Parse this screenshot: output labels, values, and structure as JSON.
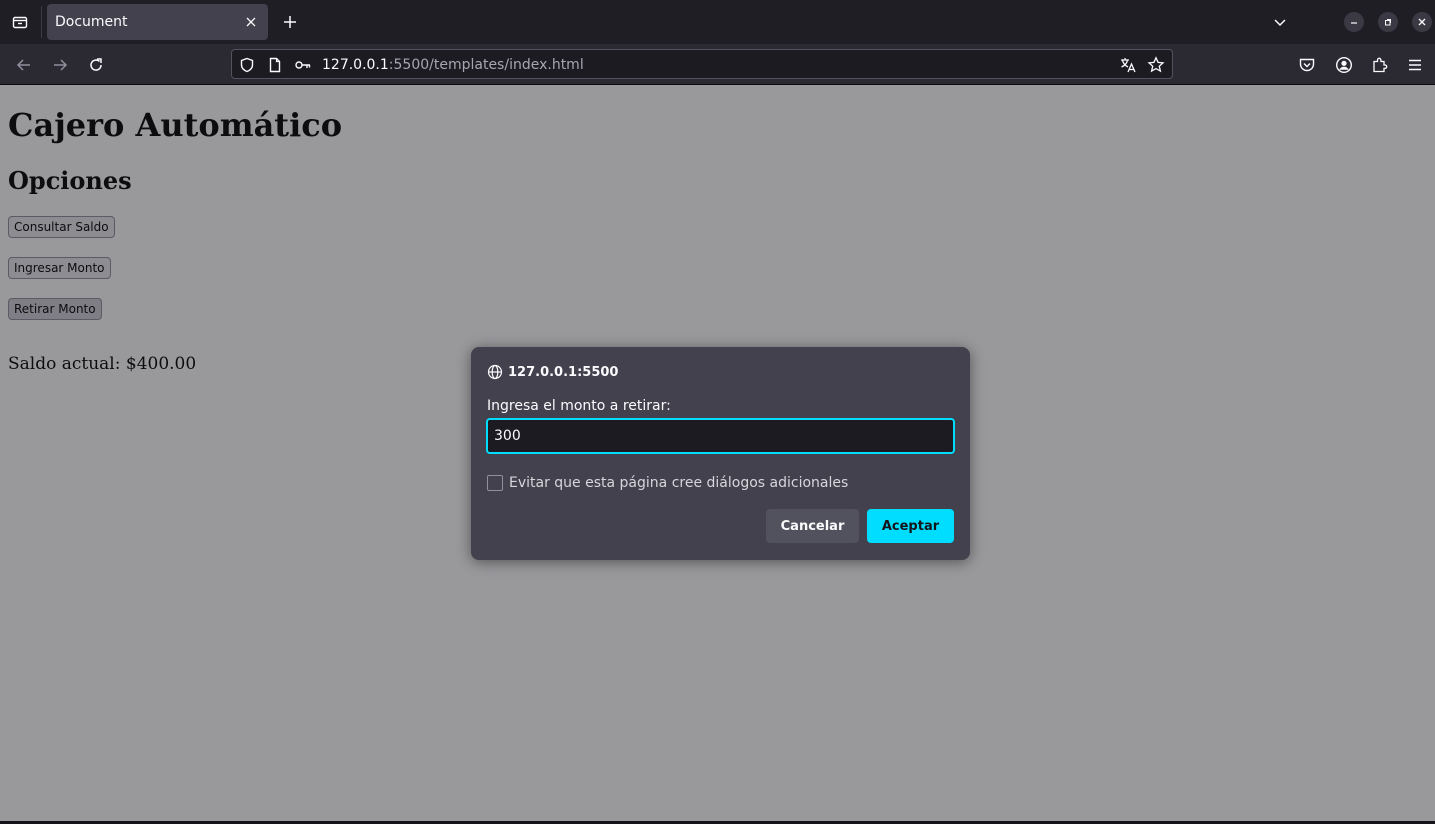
{
  "browser": {
    "tab": {
      "title": "Document"
    },
    "url": {
      "host": "127.0.0.1",
      "path": ":5500/templates/index.html"
    }
  },
  "page": {
    "title": "Cajero Automático",
    "subtitle": "Opciones",
    "buttons": {
      "check_balance": "Consultar Saldo",
      "deposit": "Ingresar Monto",
      "withdraw": "Retirar Monto"
    },
    "balance_text": "Saldo actual: $400.00"
  },
  "dialog": {
    "origin": "127.0.0.1:5500",
    "message": "Ingresa el monto a retirar:",
    "input_value": "300",
    "checkbox_label": "Evitar que esta página cree diálogos adicionales",
    "checkbox_checked": false,
    "cancel_label": "Cancelar",
    "accept_label": "Aceptar"
  },
  "colors": {
    "accent": "#00ddff",
    "toolbar": "#2b2a33",
    "dialog": "#42414d"
  }
}
